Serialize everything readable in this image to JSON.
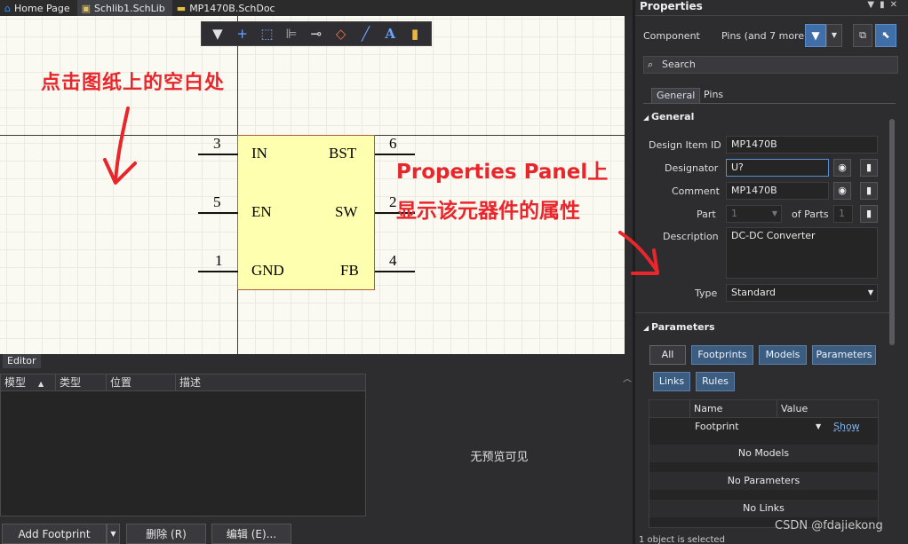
{
  "tabs": [
    {
      "label": "Home Page"
    },
    {
      "label": "Schlib1.SchLib"
    },
    {
      "label": "MP1470B.SchDoc"
    }
  ],
  "annotations": {
    "click_hint": "点击图纸上的空白处",
    "panel_hint_1": "Properties Panel上",
    "panel_hint_2": "显示该元器件的属性"
  },
  "component": {
    "pins": [
      {
        "num": "3",
        "name": "IN"
      },
      {
        "num": "5",
        "name": "EN"
      },
      {
        "num": "1",
        "name": "GND"
      },
      {
        "num": "6",
        "name": "BST"
      },
      {
        "num": "2",
        "name": "SW"
      },
      {
        "num": "4",
        "name": "FB"
      }
    ]
  },
  "editor": {
    "tab_label": "Editor",
    "columns": [
      "模型",
      "类型",
      "位置",
      "描述"
    ],
    "no_preview": "无预览可见",
    "buttons": {
      "add_footprint": "Add Footprint",
      "delete": "删除 (R)",
      "edit": "编辑 (E)..."
    }
  },
  "properties": {
    "title": "Properties",
    "filter_label": "Component",
    "filter_value": "Pins (and 7 more)",
    "search_placeholder": "Search",
    "tabs": [
      "General",
      "Pins"
    ],
    "general_title": "General",
    "design_item_id_label": "Design Item ID",
    "design_item_id": "MP1470B",
    "designator_label": "Designator",
    "designator": "U?",
    "comment_label": "Comment",
    "comment": "MP1470B",
    "part_label": "Part",
    "part_value": "1",
    "of_parts_label": "of Parts",
    "of_parts_value": "1",
    "description_label": "Description",
    "description": "DC-DC Converter",
    "type_label": "Type",
    "type_value": "Standard",
    "parameters_title": "Parameters",
    "param_buttons": [
      "All",
      "Footprints",
      "Models",
      "Parameters",
      "Links",
      "Rules"
    ],
    "table_headers": [
      "Name",
      "Value"
    ],
    "footprint_row": {
      "name": "Footprint",
      "value": "Show"
    },
    "no_models": "No Models",
    "no_parameters": "No Parameters",
    "no_links": "No Links",
    "status": "1 object is selected"
  },
  "watermark": "CSDN @fdajiekong"
}
